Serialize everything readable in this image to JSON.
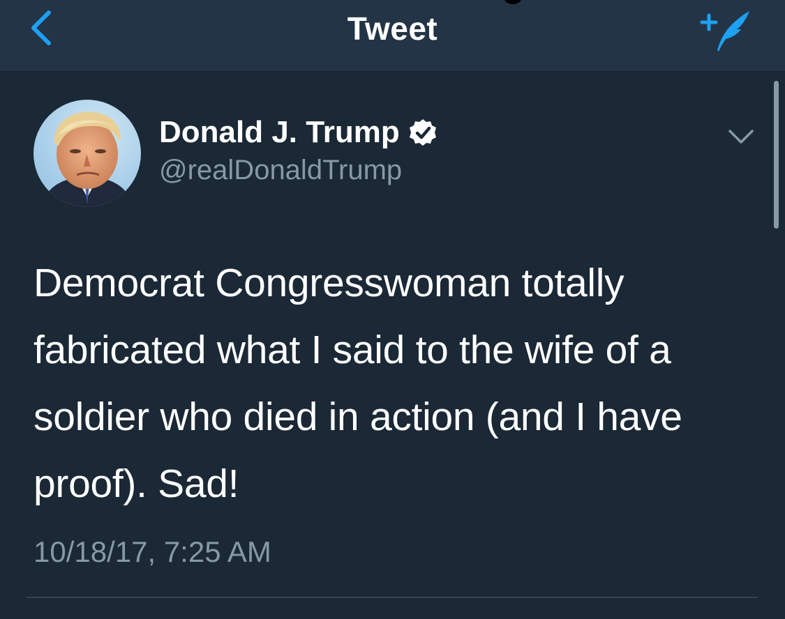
{
  "header": {
    "title": "Tweet",
    "back_icon": "chevron-left-icon",
    "compose_icon": "compose-quill-icon",
    "accent_color": "#1da1f2"
  },
  "tweet": {
    "author": {
      "display_name": "Donald J. Trump",
      "handle": "@realDonaldTrump",
      "verified": true,
      "avatar_icon": "profile-photo"
    },
    "text": "Democrat Congresswoman totally\nfabricated what I said to the wife of a\nsoldier who died in action (and I have\nproof). Sad!",
    "timestamp": "10/18/17, 7:25 AM",
    "menu_icon": "chevron-down-icon"
  },
  "theme": {
    "background": "#1b2836",
    "navbar": "#243447",
    "text_primary": "#ffffff",
    "text_secondary": "#8899a6"
  }
}
